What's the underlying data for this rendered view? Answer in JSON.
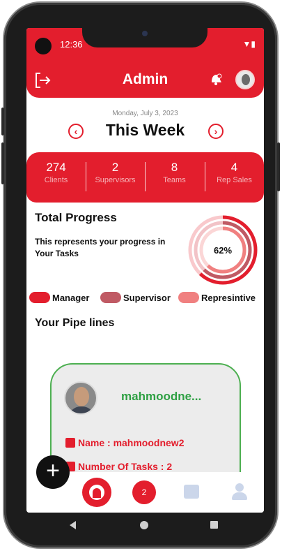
{
  "status_bar": {
    "time": "12:36"
  },
  "appbar": {
    "title": "Admin"
  },
  "date": {
    "full": "Monday, July 3, 2023",
    "label": "This Week",
    "prev": "‹",
    "next": "›"
  },
  "stats": [
    {
      "value": "274",
      "label": "Clients"
    },
    {
      "value": "2",
      "label": "Supervisors"
    },
    {
      "value": "8",
      "label": "Teams"
    },
    {
      "value": "4",
      "label": "Rep Sales"
    }
  ],
  "progress": {
    "heading": "Total Progress",
    "description": "This represents your progress in Your Tasks",
    "percent_label": "62%",
    "percent": 62
  },
  "legend": [
    {
      "label": "Manager",
      "color": "#e31e2d"
    },
    {
      "label": "Supervisor",
      "color": "#c05a64"
    },
    {
      "label": "Represintive",
      "color": "#f08080"
    }
  ],
  "pipelines": {
    "heading": "Your Pipe lines",
    "card": {
      "name": "mahmoodne...",
      "name_line": "Name : mahmoodnew2",
      "tasks_line": "Number Of Tasks : 2"
    }
  },
  "fab": {
    "label": "+"
  },
  "bottom_nav": {
    "badge": "2"
  },
  "colors": {
    "primary": "#e31e2d",
    "card_border": "#4caf50",
    "card_name": "#2ea043"
  }
}
